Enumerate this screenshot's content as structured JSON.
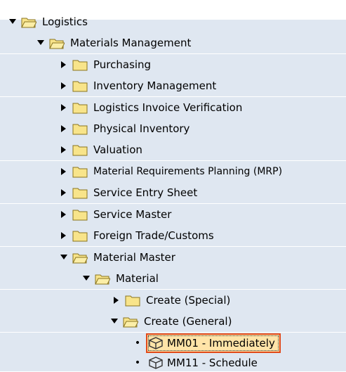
{
  "tree": {
    "nodes": [
      {
        "label": "Logistics",
        "type": "folder",
        "expanded": true
      },
      {
        "label": "Materials Management",
        "type": "folder",
        "expanded": true
      },
      {
        "label": "Purchasing",
        "type": "folder",
        "expanded": false
      },
      {
        "label": "Inventory Management",
        "type": "folder",
        "expanded": false
      },
      {
        "label": "Logistics Invoice Verification",
        "type": "folder",
        "expanded": false
      },
      {
        "label": "Physical Inventory",
        "type": "folder",
        "expanded": false
      },
      {
        "label": "Valuation",
        "type": "folder",
        "expanded": false
      },
      {
        "label": "Material Requirements Planning (MRP)",
        "type": "folder",
        "expanded": false
      },
      {
        "label": "Service Entry Sheet",
        "type": "folder",
        "expanded": false
      },
      {
        "label": "Service Master",
        "type": "folder",
        "expanded": false
      },
      {
        "label": "Foreign Trade/Customs",
        "type": "folder",
        "expanded": false
      },
      {
        "label": "Material Master",
        "type": "folder",
        "expanded": true
      },
      {
        "label": "Material",
        "type": "folder",
        "expanded": true
      },
      {
        "label": "Create (Special)",
        "type": "folder",
        "expanded": false
      },
      {
        "label": "Create (General)",
        "type": "folder",
        "expanded": true
      },
      {
        "label": "MM01 - Immediately",
        "type": "transaction",
        "selected": true
      },
      {
        "label": "MM11 - Schedule",
        "type": "transaction",
        "selected": false
      }
    ]
  },
  "colors": {
    "band": "#dfe7f1",
    "folder_fill": "#f8e48a",
    "folder_stroke": "#8a7420",
    "selection_fill": "#ffe4a8",
    "selection_border": "#e24a1a"
  },
  "icons": {
    "expanded": "triangle-down-icon",
    "collapsed": "triangle-right-icon",
    "folder": "folder-icon",
    "open_folder": "folder-open-icon",
    "transaction": "transaction-cube-icon"
  }
}
